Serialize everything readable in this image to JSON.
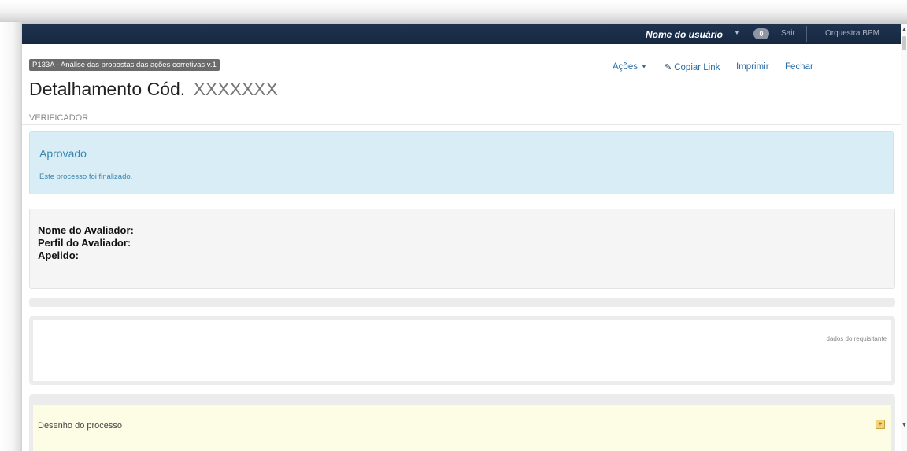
{
  "navbar": {
    "user_name": "Nome do usuário",
    "caret": "▼",
    "notification_count": "0",
    "logout_label": "Sair",
    "brand": "Orquestra BPM"
  },
  "header": {
    "process_label": "P133A - Análise das propostas das ações corretivas v.1",
    "title": "Detalhamento Cód.",
    "code": "XXXXXXX",
    "role": "VERIFICADOR"
  },
  "actions": {
    "actions_label": "Ações",
    "copy_link_label": "Copiar Link",
    "print_label": "Imprimir",
    "close_label": "Fechar"
  },
  "status": {
    "title": "Aprovado",
    "message": "Este processo foi finalizado.",
    "color": "#d9edf7"
  },
  "evaluator": {
    "name_label": "Nome do Avaliador:",
    "profile_label": "Perfil do Avaliador:",
    "nickname_label": "Apelido:"
  },
  "requester_panel": {
    "note": "dados do requisitante"
  },
  "process_panel": {
    "title": "Desenho do processo"
  },
  "colors": {
    "navbar": "#1c2f4a",
    "link": "#2b6ea8",
    "alert_text": "#3a87ad"
  }
}
